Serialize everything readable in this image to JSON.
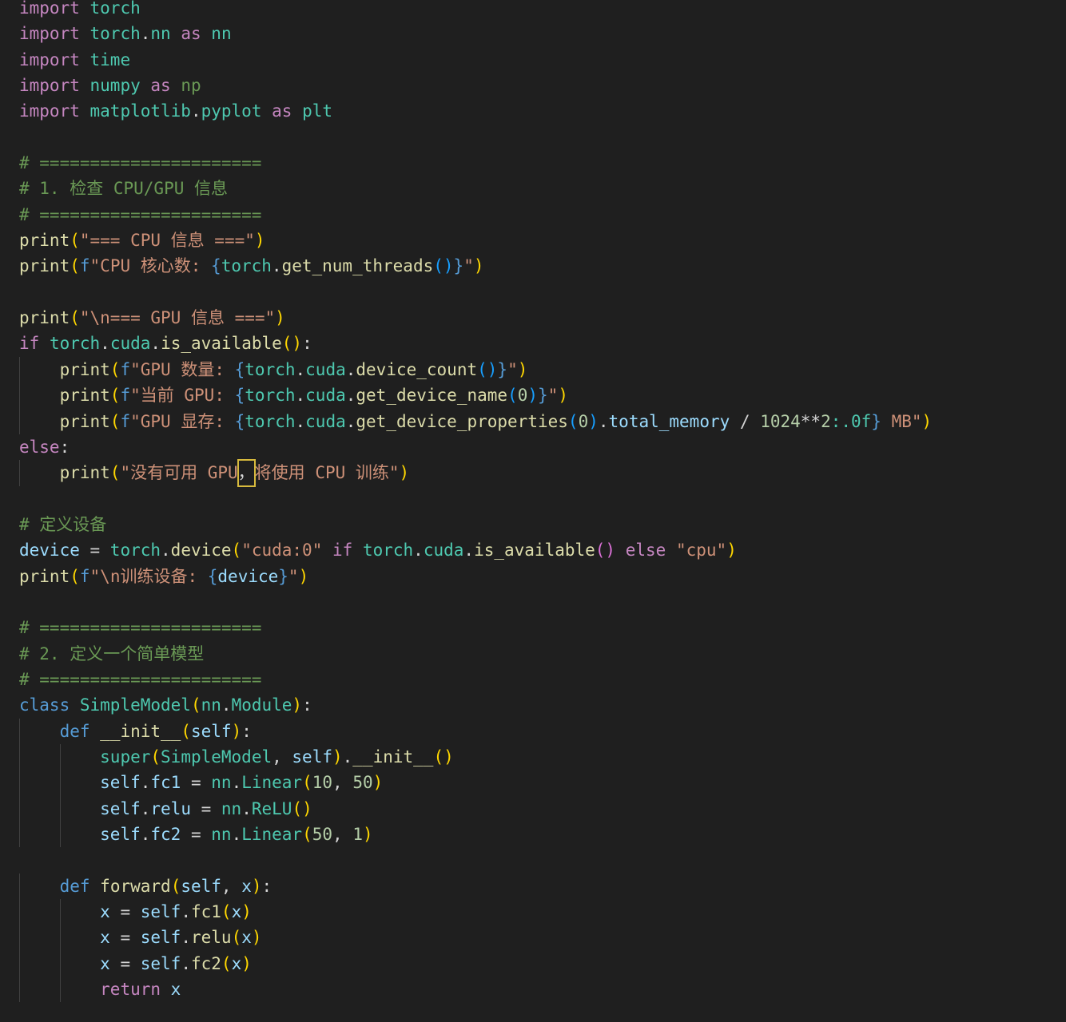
{
  "app": {
    "kind": "code-editor",
    "language": "python",
    "theme": "dark"
  },
  "colors": {
    "background": "#1f1f1f",
    "keyword_control": "#c586c0",
    "keyword_decl": "#569cd6",
    "module_or_type": "#4ec9b0",
    "function": "#dcdcaa",
    "variable": "#9cdcfe",
    "string": "#ce9178",
    "number": "#b5cea8",
    "comment": "#6a9955",
    "brace_level1": "#ffd700",
    "brace_level2": "#da70d6",
    "brace_level3": "#179fff",
    "plain": "#d4d4d4",
    "indent_guide": "#404040",
    "cursor_highlight": "#d7ba3d"
  },
  "code_lines": [
    {
      "indent": 0,
      "tokens": [
        [
          "import",
          "kc"
        ],
        [
          " ",
          "p"
        ],
        [
          "torch",
          "mod"
        ]
      ]
    },
    {
      "indent": 0,
      "tokens": [
        [
          "import",
          "kc"
        ],
        [
          " ",
          "p"
        ],
        [
          "torch",
          "mod"
        ],
        [
          ".",
          "p"
        ],
        [
          "nn",
          "mod"
        ],
        [
          " ",
          "p"
        ],
        [
          "as",
          "kc"
        ],
        [
          " ",
          "p"
        ],
        [
          "nn",
          "mod"
        ]
      ]
    },
    {
      "indent": 0,
      "tokens": [
        [
          "import",
          "kc"
        ],
        [
          " ",
          "p"
        ],
        [
          "time",
          "mod"
        ]
      ]
    },
    {
      "indent": 0,
      "tokens": [
        [
          "import",
          "kc"
        ],
        [
          " ",
          "p"
        ],
        [
          "numpy",
          "mod"
        ],
        [
          " ",
          "p"
        ],
        [
          "as",
          "kc"
        ],
        [
          " ",
          "p"
        ],
        [
          "np",
          "modg"
        ]
      ]
    },
    {
      "indent": 0,
      "tokens": [
        [
          "import",
          "kc"
        ],
        [
          " ",
          "p"
        ],
        [
          "matplotlib",
          "mod"
        ],
        [
          ".",
          "p"
        ],
        [
          "pyplot",
          "mod"
        ],
        [
          " ",
          "p"
        ],
        [
          "as",
          "kc"
        ],
        [
          " ",
          "p"
        ],
        [
          "plt",
          "mod"
        ]
      ]
    },
    {
      "indent": 0,
      "tokens": []
    },
    {
      "indent": 0,
      "tokens": [
        [
          "# ======================",
          "com"
        ]
      ]
    },
    {
      "indent": 0,
      "tokens": [
        [
          "# 1. 检查 CPU/GPU 信息",
          "com"
        ]
      ]
    },
    {
      "indent": 0,
      "tokens": [
        [
          "# ======================",
          "com"
        ]
      ]
    },
    {
      "indent": 0,
      "tokens": [
        [
          "print",
          "fn"
        ],
        [
          "(",
          "b1"
        ],
        [
          "\"=== CPU 信息 ===\"",
          "str"
        ],
        [
          ")",
          "b1"
        ]
      ]
    },
    {
      "indent": 0,
      "tokens": [
        [
          "print",
          "fn"
        ],
        [
          "(",
          "b1"
        ],
        [
          "f",
          "kw"
        ],
        [
          "\"CPU 核心数: ",
          "str"
        ],
        [
          "{",
          "kw"
        ],
        [
          "torch",
          "mod"
        ],
        [
          ".",
          "p"
        ],
        [
          "get_num_threads",
          "fn"
        ],
        [
          "()",
          "b3"
        ],
        [
          "}",
          "kw"
        ],
        [
          "\"",
          "str"
        ],
        [
          ")",
          "b1"
        ]
      ]
    },
    {
      "indent": 0,
      "tokens": []
    },
    {
      "indent": 0,
      "tokens": [
        [
          "print",
          "fn"
        ],
        [
          "(",
          "b1"
        ],
        [
          "\"\\n=== GPU 信息 ===\"",
          "str"
        ],
        [
          ")",
          "b1"
        ]
      ]
    },
    {
      "indent": 0,
      "tokens": [
        [
          "if",
          "kc"
        ],
        [
          " ",
          "p"
        ],
        [
          "torch",
          "mod"
        ],
        [
          ".",
          "p"
        ],
        [
          "cuda",
          "mod"
        ],
        [
          ".",
          "p"
        ],
        [
          "is_available",
          "fn"
        ],
        [
          "()",
          "b1"
        ],
        [
          ":",
          "p"
        ]
      ]
    },
    {
      "indent": 1,
      "tokens": [
        [
          "print",
          "fn"
        ],
        [
          "(",
          "b1"
        ],
        [
          "f",
          "kw"
        ],
        [
          "\"GPU 数量: ",
          "str"
        ],
        [
          "{",
          "kw"
        ],
        [
          "torch",
          "mod"
        ],
        [
          ".",
          "p"
        ],
        [
          "cuda",
          "mod"
        ],
        [
          ".",
          "p"
        ],
        [
          "device_count",
          "fn"
        ],
        [
          "()",
          "b3"
        ],
        [
          "}",
          "kw"
        ],
        [
          "\"",
          "str"
        ],
        [
          ")",
          "b1"
        ]
      ]
    },
    {
      "indent": 1,
      "tokens": [
        [
          "print",
          "fn"
        ],
        [
          "(",
          "b1"
        ],
        [
          "f",
          "kw"
        ],
        [
          "\"当前 GPU: ",
          "str"
        ],
        [
          "{",
          "kw"
        ],
        [
          "torch",
          "mod"
        ],
        [
          ".",
          "p"
        ],
        [
          "cuda",
          "mod"
        ],
        [
          ".",
          "p"
        ],
        [
          "get_device_name",
          "fn"
        ],
        [
          "(",
          "b3"
        ],
        [
          "0",
          "num"
        ],
        [
          ")",
          "b3"
        ],
        [
          "}",
          "kw"
        ],
        [
          "\"",
          "str"
        ],
        [
          ")",
          "b1"
        ]
      ]
    },
    {
      "indent": 1,
      "tokens": [
        [
          "print",
          "fn"
        ],
        [
          "(",
          "b1"
        ],
        [
          "f",
          "kw"
        ],
        [
          "\"GPU 显存: ",
          "str"
        ],
        [
          "{",
          "kw"
        ],
        [
          "torch",
          "mod"
        ],
        [
          ".",
          "p"
        ],
        [
          "cuda",
          "mod"
        ],
        [
          ".",
          "p"
        ],
        [
          "get_device_properties",
          "fn"
        ],
        [
          "(",
          "b3"
        ],
        [
          "0",
          "num"
        ],
        [
          ")",
          "b3"
        ],
        [
          ".",
          "p"
        ],
        [
          "total_memory",
          "var"
        ],
        [
          " / ",
          "p"
        ],
        [
          "1024",
          "num"
        ],
        [
          "**",
          "p"
        ],
        [
          "2",
          "num"
        ],
        [
          ":.0f",
          "str2"
        ],
        [
          "}",
          "kw"
        ],
        [
          " MB\"",
          "str"
        ],
        [
          ")",
          "b1"
        ]
      ]
    },
    {
      "indent": 0,
      "tokens": [
        [
          "else",
          "kc"
        ],
        [
          ":",
          "p"
        ]
      ]
    },
    {
      "indent": 1,
      "tokens": [
        [
          "print",
          "fn"
        ],
        [
          "(",
          "b1"
        ],
        [
          "\"没有可用 GPU",
          "str"
        ],
        [
          "，",
          "cursor"
        ],
        [
          "将使用 CPU 训练\"",
          "str"
        ],
        [
          ")",
          "b1"
        ]
      ]
    },
    {
      "indent": 0,
      "tokens": []
    },
    {
      "indent": 0,
      "tokens": [
        [
          "# 定义设备",
          "com"
        ]
      ]
    },
    {
      "indent": 0,
      "tokens": [
        [
          "device",
          "var"
        ],
        [
          " = ",
          "p"
        ],
        [
          "torch",
          "mod"
        ],
        [
          ".",
          "p"
        ],
        [
          "device",
          "fn"
        ],
        [
          "(",
          "b1"
        ],
        [
          "\"cuda:0\"",
          "str"
        ],
        [
          " ",
          "p"
        ],
        [
          "if",
          "kc"
        ],
        [
          " ",
          "p"
        ],
        [
          "torch",
          "mod"
        ],
        [
          ".",
          "p"
        ],
        [
          "cuda",
          "mod"
        ],
        [
          ".",
          "p"
        ],
        [
          "is_available",
          "fn"
        ],
        [
          "()",
          "b2"
        ],
        [
          " ",
          "p"
        ],
        [
          "else",
          "kc"
        ],
        [
          " ",
          "p"
        ],
        [
          "\"cpu\"",
          "str"
        ],
        [
          ")",
          "b1"
        ]
      ]
    },
    {
      "indent": 0,
      "tokens": [
        [
          "print",
          "fn"
        ],
        [
          "(",
          "b1"
        ],
        [
          "f",
          "kw"
        ],
        [
          "\"\\n训练设备: ",
          "str"
        ],
        [
          "{",
          "kw"
        ],
        [
          "device",
          "var"
        ],
        [
          "}",
          "kw"
        ],
        [
          "\"",
          "str"
        ],
        [
          ")",
          "b1"
        ]
      ]
    },
    {
      "indent": 0,
      "tokens": []
    },
    {
      "indent": 0,
      "tokens": [
        [
          "# ======================",
          "com"
        ]
      ]
    },
    {
      "indent": 0,
      "tokens": [
        [
          "# 2. 定义一个简单模型",
          "com"
        ]
      ]
    },
    {
      "indent": 0,
      "tokens": [
        [
          "# ======================",
          "com"
        ]
      ]
    },
    {
      "indent": 0,
      "tokens": [
        [
          "class",
          "kw"
        ],
        [
          " ",
          "p"
        ],
        [
          "SimpleModel",
          "mod"
        ],
        [
          "(",
          "b1"
        ],
        [
          "nn",
          "mod"
        ],
        [
          ".",
          "p"
        ],
        [
          "Module",
          "mod"
        ],
        [
          ")",
          "b1"
        ],
        [
          ":",
          "p"
        ]
      ]
    },
    {
      "indent": 1,
      "tokens": [
        [
          "def",
          "kw"
        ],
        [
          " ",
          "p"
        ],
        [
          "__init__",
          "fn"
        ],
        [
          "(",
          "b1"
        ],
        [
          "self",
          "var"
        ],
        [
          ")",
          "b1"
        ],
        [
          ":",
          "p"
        ]
      ]
    },
    {
      "indent": 2,
      "tokens": [
        [
          "super",
          "mod"
        ],
        [
          "(",
          "b1"
        ],
        [
          "SimpleModel",
          "mod"
        ],
        [
          ", ",
          "p"
        ],
        [
          "self",
          "var"
        ],
        [
          ")",
          "b1"
        ],
        [
          ".",
          "p"
        ],
        [
          "__init__",
          "fn"
        ],
        [
          "()",
          "b1"
        ]
      ]
    },
    {
      "indent": 2,
      "tokens": [
        [
          "self",
          "var"
        ],
        [
          ".",
          "p"
        ],
        [
          "fc1",
          "var"
        ],
        [
          " = ",
          "p"
        ],
        [
          "nn",
          "mod"
        ],
        [
          ".",
          "p"
        ],
        [
          "Linear",
          "mod"
        ],
        [
          "(",
          "b1"
        ],
        [
          "10",
          "num"
        ],
        [
          ", ",
          "p"
        ],
        [
          "50",
          "num"
        ],
        [
          ")",
          "b1"
        ]
      ]
    },
    {
      "indent": 2,
      "tokens": [
        [
          "self",
          "var"
        ],
        [
          ".",
          "p"
        ],
        [
          "relu",
          "var"
        ],
        [
          " = ",
          "p"
        ],
        [
          "nn",
          "mod"
        ],
        [
          ".",
          "p"
        ],
        [
          "ReLU",
          "mod"
        ],
        [
          "()",
          "b1"
        ]
      ]
    },
    {
      "indent": 2,
      "tokens": [
        [
          "self",
          "var"
        ],
        [
          ".",
          "p"
        ],
        [
          "fc2",
          "var"
        ],
        [
          " = ",
          "p"
        ],
        [
          "nn",
          "mod"
        ],
        [
          ".",
          "p"
        ],
        [
          "Linear",
          "mod"
        ],
        [
          "(",
          "b1"
        ],
        [
          "50",
          "num"
        ],
        [
          ", ",
          "p"
        ],
        [
          "1",
          "num"
        ],
        [
          ")",
          "b1"
        ]
      ]
    },
    {
      "indent": 0,
      "tokens": []
    },
    {
      "indent": 1,
      "tokens": [
        [
          "def",
          "kw"
        ],
        [
          " ",
          "p"
        ],
        [
          "forward",
          "fn"
        ],
        [
          "(",
          "b1"
        ],
        [
          "self",
          "var"
        ],
        [
          ", ",
          "p"
        ],
        [
          "x",
          "var"
        ],
        [
          ")",
          "b1"
        ],
        [
          ":",
          "p"
        ]
      ]
    },
    {
      "indent": 2,
      "tokens": [
        [
          "x",
          "var"
        ],
        [
          " = ",
          "p"
        ],
        [
          "self",
          "var"
        ],
        [
          ".",
          "p"
        ],
        [
          "fc1",
          "fn"
        ],
        [
          "(",
          "b1"
        ],
        [
          "x",
          "var"
        ],
        [
          ")",
          "b1"
        ]
      ]
    },
    {
      "indent": 2,
      "tokens": [
        [
          "x",
          "var"
        ],
        [
          " = ",
          "p"
        ],
        [
          "self",
          "var"
        ],
        [
          ".",
          "p"
        ],
        [
          "relu",
          "fn"
        ],
        [
          "(",
          "b1"
        ],
        [
          "x",
          "var"
        ],
        [
          ")",
          "b1"
        ]
      ]
    },
    {
      "indent": 2,
      "tokens": [
        [
          "x",
          "var"
        ],
        [
          " = ",
          "p"
        ],
        [
          "self",
          "var"
        ],
        [
          ".",
          "p"
        ],
        [
          "fc2",
          "fn"
        ],
        [
          "(",
          "b1"
        ],
        [
          "x",
          "var"
        ],
        [
          ")",
          "b1"
        ]
      ]
    },
    {
      "indent": 2,
      "tokens": [
        [
          "return",
          "kc"
        ],
        [
          " ",
          "p"
        ],
        [
          "x",
          "var"
        ]
      ]
    }
  ]
}
